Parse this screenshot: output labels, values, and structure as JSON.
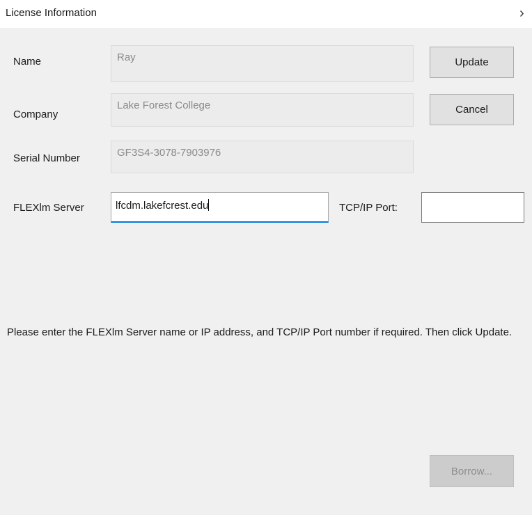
{
  "window": {
    "title": "License Information",
    "close_glyph": "›"
  },
  "form": {
    "name_label": "Name",
    "name_value": "Ray",
    "company_label": "Company",
    "company_value": "Lake Forest College",
    "serial_label": "Serial Number",
    "serial_value": "GF3S4-3078-7903976",
    "server_label": "FLEXlm Server",
    "server_value": "lfcdm.lakefcrest.edu",
    "port_label": "TCP/IP Port:",
    "port_value": ""
  },
  "buttons": {
    "update_label": "Update",
    "cancel_label": "Cancel",
    "borrow_label": "Borrow..."
  },
  "instructions": "Please enter the FLEXlm Server name or IP address, and TCP/IP Port number if required. Then click Update.",
  "colors": {
    "dialog_background": "#f0f0f0",
    "titlebar_background": "#ffffff",
    "focus_accent": "#0078d7",
    "disabled_button": "#cccccc"
  }
}
